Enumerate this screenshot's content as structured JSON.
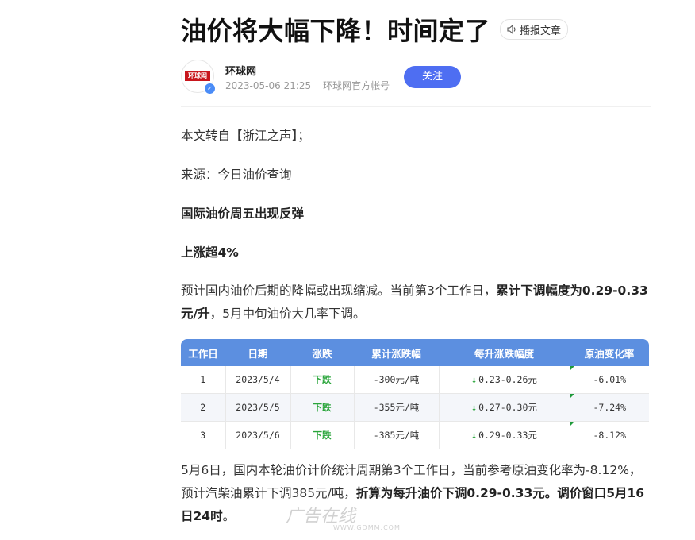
{
  "article": {
    "title": "油价将大幅下降！时间定了",
    "listen_label": "播报文章"
  },
  "author": {
    "logo_text": "环球网",
    "name": "环球网",
    "datetime": "2023-05-06 21:25",
    "account": "环球网官方帐号",
    "follow_label": "关注"
  },
  "body": {
    "p1": "本文转自【浙江之声】；",
    "p2": "来源：今日油价查询",
    "p3": "国际油价周五出现反弹",
    "p4": "上涨超4%",
    "p5_a": "预计国内油价后期的降幅或出现缩减。当前第3个工作日，",
    "p5_b": "累计下调幅度为0.29-0.33元/升",
    "p5_c": "，5月中旬油价大几率下调。",
    "p6_a": "5月6日，国内本轮油价计价统计周期第3个工作日，当前参考原油变化率为-8.12%，预计汽柴油累计下调385元/吨，",
    "p6_b": "折算为每升油价下调0.29-0.33元。调价窗口5月16日24时",
    "p6_c": "。"
  },
  "table": {
    "headers": [
      "工作日",
      "日期",
      "涨跌",
      "累计涨跌幅",
      "每升涨跌幅度",
      "原油变化率"
    ],
    "rows": [
      {
        "day": "1",
        "date": "2023/5/4",
        "trend": "下跌",
        "cumulative": "-300元/吨",
        "arrow": "↓",
        "per_liter": "0.23-0.26元",
        "crude": "-6.01%"
      },
      {
        "day": "2",
        "date": "2023/5/5",
        "trend": "下跌",
        "cumulative": "-355元/吨",
        "arrow": "↓",
        "per_liter": "0.27-0.30元",
        "crude": "-7.24%"
      },
      {
        "day": "3",
        "date": "2023/5/6",
        "trend": "下跌",
        "cumulative": "-385元/吨",
        "arrow": "↓",
        "per_liter": "0.29-0.33元",
        "crude": "-8.12%"
      }
    ]
  },
  "watermark": {
    "text": "广告在线",
    "url": "WWW.GDMM.COM"
  },
  "colors": {
    "accent": "#4e6ef2",
    "table_header": "#5c8fe0",
    "down": "#2aa53b"
  }
}
